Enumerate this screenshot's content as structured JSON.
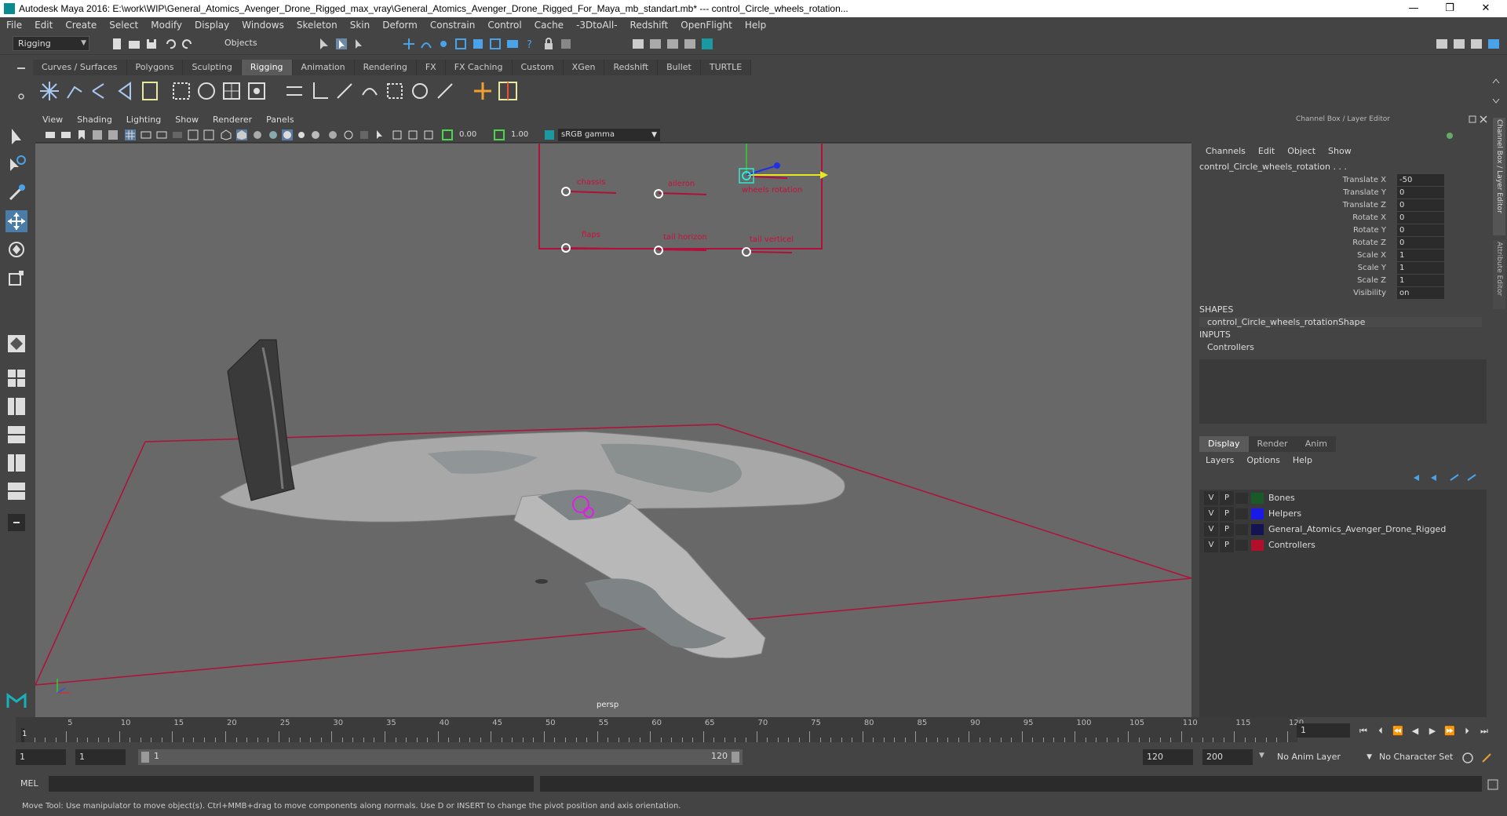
{
  "window": {
    "title": "Autodesk Maya 2016: E:\\work\\WIP\\General_Atomics_Avenger_Drone_Rigged_max_vray\\General_Atomics_Avenger_Drone_Rigged_For_Maya_mb_standart.mb*   ---   control_Circle_wheels_rotation...",
    "minimize": "—",
    "restore": "❐",
    "close": "✕"
  },
  "menubar": [
    "File",
    "Edit",
    "Create",
    "Select",
    "Modify",
    "Display",
    "Windows",
    "Skeleton",
    "Skin",
    "Deform",
    "Constrain",
    "Control",
    "Cache",
    "-3DtoAll-",
    "Redshift",
    "OpenFlight",
    "Help"
  ],
  "statusline": {
    "menuset": "Rigging",
    "selection_mode": "Objects"
  },
  "shelf_tabs": [
    {
      "label": "Curves / Surfaces",
      "active": false
    },
    {
      "label": "Polygons",
      "active": false
    },
    {
      "label": "Sculpting",
      "active": false
    },
    {
      "label": "Rigging",
      "active": true
    },
    {
      "label": "Animation",
      "active": false
    },
    {
      "label": "Rendering",
      "active": false
    },
    {
      "label": "FX",
      "active": false
    },
    {
      "label": "FX Caching",
      "active": false
    },
    {
      "label": "Custom",
      "active": false
    },
    {
      "label": "XGen",
      "active": false
    },
    {
      "label": "Redshift",
      "active": false
    },
    {
      "label": "Bullet",
      "active": false
    },
    {
      "label": "TURTLE",
      "active": false
    }
  ],
  "viewport": {
    "menu": [
      "View",
      "Shading",
      "Lighting",
      "Show",
      "Renderer",
      "Panels"
    ],
    "near_value": "0.00",
    "far_value": "1.00",
    "colorspace": "sRGB gamma",
    "camera_label": "persp",
    "controls": {
      "chassis": "chassis",
      "aileron": "aileron",
      "wheels_rotation": "wheels rotation",
      "flaps": "flaps",
      "tail_horizon": "tail horizon",
      "tail_vertical": "tail verticel"
    },
    "colors": {
      "controller_red": "#c8103c",
      "background": "#686868"
    }
  },
  "channel_box": {
    "title": "Channel Box / Layer Editor",
    "menu": [
      "Channels",
      "Edit",
      "Object",
      "Show"
    ],
    "node": "control_Circle_wheels_rotation . . .",
    "attributes": [
      {
        "name": "Translate X",
        "value": "-50"
      },
      {
        "name": "Translate Y",
        "value": "0"
      },
      {
        "name": "Translate Z",
        "value": "0"
      },
      {
        "name": "Rotate X",
        "value": "0"
      },
      {
        "name": "Rotate Y",
        "value": "0"
      },
      {
        "name": "Rotate Z",
        "value": "0"
      },
      {
        "name": "Scale X",
        "value": "1"
      },
      {
        "name": "Scale Y",
        "value": "1"
      },
      {
        "name": "Scale Z",
        "value": "1"
      },
      {
        "name": "Visibility",
        "value": "on"
      }
    ],
    "shapes_label": "SHAPES",
    "shape_name": "control_Circle_wheels_rotationShape",
    "inputs_label": "INPUTS",
    "input_name": "Controllers",
    "side_tab_1": "Channel Box / Layer Editor",
    "side_tab_2": "Attribute Editor"
  },
  "layer_editor": {
    "tabs": [
      {
        "label": "Display",
        "active": true
      },
      {
        "label": "Render",
        "active": false
      },
      {
        "label": "Anim",
        "active": false
      }
    ],
    "menu": [
      "Layers",
      "Options",
      "Help"
    ],
    "layers": [
      {
        "v": "V",
        "p": "P",
        "color": "#1a5a2a",
        "name": "Bones"
      },
      {
        "v": "V",
        "p": "P",
        "color": "#1a1ae8",
        "name": "Helpers"
      },
      {
        "v": "V",
        "p": "P",
        "color": "#141450",
        "name": "General_Atomics_Avenger_Drone_Rigged"
      },
      {
        "v": "V",
        "p": "P",
        "color": "#b0102a",
        "name": "Controllers"
      }
    ]
  },
  "timeline": {
    "start": 1,
    "end": 120,
    "labels": [
      "5",
      "10",
      "15",
      "20",
      "25",
      "30",
      "35",
      "40",
      "45",
      "50",
      "55",
      "60",
      "65",
      "70",
      "75",
      "80",
      "85",
      "90",
      "95",
      "100",
      "105",
      "110",
      "115",
      "120"
    ],
    "first_label": "1",
    "current_frame": "1"
  },
  "range": {
    "start_field": "1",
    "playback_start": "1",
    "slider_start": "1",
    "slider_end": "120",
    "playback_end": "120",
    "end_field": "200",
    "anim_layer": "No Anim Layer",
    "character_set": "No Character Set"
  },
  "cmdline": {
    "label": "MEL"
  },
  "helpline": {
    "text": "Move Tool: Use manipulator to move object(s). Ctrl+MMB+drag to move components along normals. Use D or INSERT to change the pivot position and axis orientation."
  }
}
